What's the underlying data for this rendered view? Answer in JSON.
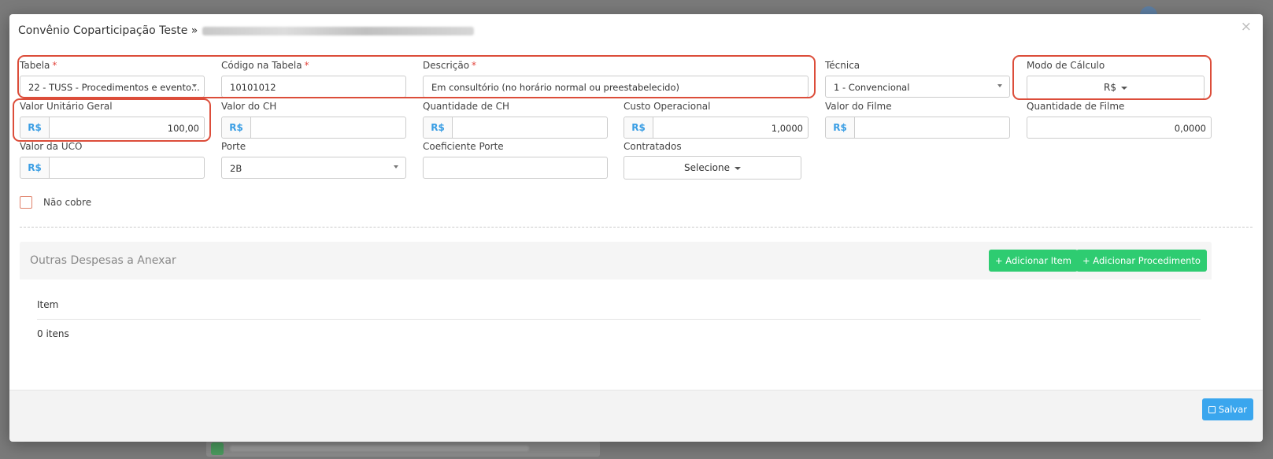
{
  "modal": {
    "title": "Convênio Coparticipação Teste »",
    "close": "×"
  },
  "fields": {
    "tabela": {
      "label": "Tabela",
      "required": "*",
      "value": "22 - TUSS - Procedimentos e evento..."
    },
    "codigo": {
      "label": "Código na Tabela",
      "required": "*",
      "value": "10101012"
    },
    "descricao": {
      "label": "Descrição",
      "required": "*",
      "value": "Em consultório (no horário normal ou preestabelecido)"
    },
    "tecnica": {
      "label": "Técnica",
      "value": "1 - Convencional"
    },
    "modo_calculo": {
      "label": "Modo de Cálculo",
      "value": "R$"
    },
    "valor_unitario": {
      "label": "Valor Unitário Geral",
      "prefix": "R$",
      "value": "100,00"
    },
    "valor_ch": {
      "label": "Valor do CH",
      "prefix": "R$",
      "value": ""
    },
    "quantidade_ch": {
      "label": "Quantidade de CH",
      "prefix": "R$",
      "value": ""
    },
    "custo_operacional": {
      "label": "Custo Operacional",
      "prefix": "R$",
      "value": "1,0000"
    },
    "valor_filme": {
      "label": "Valor do Filme",
      "prefix": "R$",
      "value": ""
    },
    "quantidade_filme": {
      "label": "Quantidade de Filme",
      "value": "0,0000"
    },
    "valor_uco": {
      "label": "Valor da UCO",
      "prefix": "R$",
      "value": ""
    },
    "porte": {
      "label": "Porte",
      "value": "2B"
    },
    "coeficiente_porte": {
      "label": "Coeficiente Porte",
      "value": ""
    },
    "contratados": {
      "label": "Contratados",
      "value": "Selecione"
    }
  },
  "nao_cobre": {
    "label": "Não cobre",
    "checked": false
  },
  "outras_despesas": {
    "title": "Outras Despesas a Anexar",
    "add_item": "+ Adicionar Item",
    "add_procedimento": "+ Adicionar Procedimento",
    "column_item": "Item",
    "count": "0 itens"
  },
  "footer": {
    "save": "Salvar"
  },
  "colors": {
    "accent": "#3aa6ee",
    "success": "#2ecc71",
    "required": "#e2453c",
    "highlight": "#dc4d3a"
  }
}
